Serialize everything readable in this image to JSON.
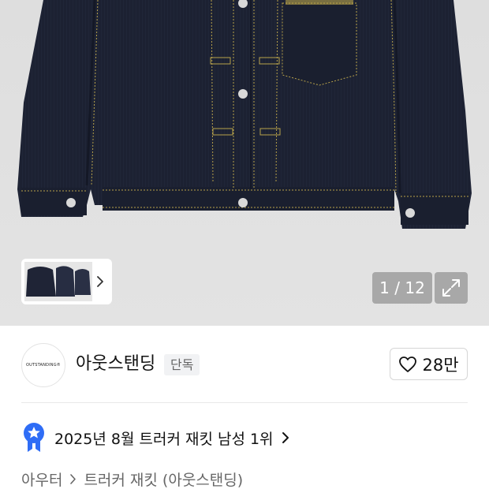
{
  "gallery": {
    "current_page": 1,
    "total_pages": 12,
    "counter_text": "1 / 12",
    "image_icons": [
      "chevron-right-icon",
      "expand-icon"
    ]
  },
  "brand": {
    "logo_text": "OUTSTANDING®",
    "name": "아웃스탠딩",
    "badge": "단독"
  },
  "like": {
    "icon": "heart-icon",
    "count": "28만"
  },
  "ranking": {
    "icon": "star-ribbon-icon",
    "text": "2025년 8월 트러커 재킷 남성 1위",
    "accent_color": "#2f6df6"
  },
  "breadcrumb": {
    "items": [
      "아우터",
      "트러커 재킷 (아웃스탠딩)"
    ]
  },
  "colors": {
    "denim": "#1d2233",
    "stitch": "#b8a24a"
  }
}
